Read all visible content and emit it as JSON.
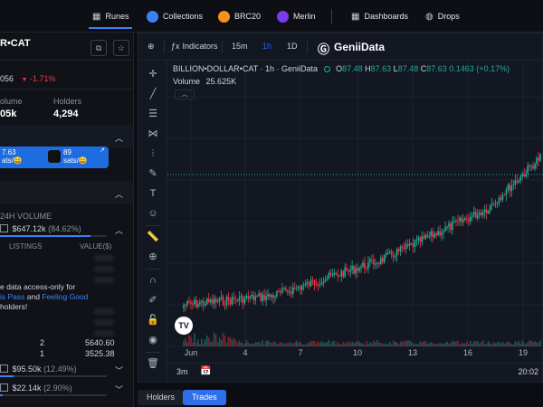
{
  "nav": {
    "items": [
      {
        "label": "Runes",
        "icon": "grid-icon"
      },
      {
        "label": "Collections",
        "icon": "collections-icon"
      },
      {
        "label": "BRC20",
        "icon": "brc20-icon"
      },
      {
        "label": "Merlin",
        "icon": "merlin-icon"
      },
      {
        "label": "Dashboards",
        "icon": "dashboard-icon"
      },
      {
        "label": "Drops",
        "icon": "drops-icon"
      }
    ],
    "active": "Runes"
  },
  "token": {
    "name_partial": "R•CAT",
    "price_partial": "056",
    "change": "-1.71%",
    "volume_label_partial": "olume",
    "volume_value_partial": "05k",
    "holders_label": "Holders",
    "holders_value": "4,294"
  },
  "cards": [
    {
      "value_partial": "7.63",
      "sub_partial": "ats/"
    },
    {
      "value": "89",
      "sub": "sats/"
    }
  ],
  "market": {
    "header_partial": "24H VOLUME",
    "first": {
      "value": "$647.12k",
      "pct": "(84.62%)",
      "fill_pct": 84.62
    },
    "listings_label": "LISTINGS",
    "value_label": "VALUE($)",
    "notice_line1": "e data access-only for",
    "notice_link1_partial": "is Pass",
    "notice_and": "and",
    "notice_link2": "Feeling Good",
    "notice_line3": "holders!",
    "rows": [
      {
        "listings": "2",
        "value": "5640.60"
      },
      {
        "listings": "1",
        "value": "3525.38"
      }
    ],
    "second": {
      "value": "$95.50k",
      "pct": "(12.49%)",
      "fill_pct": 12.49
    },
    "third": {
      "value": "$22.14k",
      "pct": "(2.90%)",
      "fill_pct": 2.9
    }
  },
  "chart_toolbar": {
    "indicators": "Indicators",
    "intervals": [
      "15m",
      "1h",
      "1D"
    ],
    "active_interval": "1h",
    "brand": "GeniiData"
  },
  "legend": {
    "symbol": "BILLION•DOLLAR•CAT · 1h · GeniiData",
    "o_label": "O",
    "o": "87.48",
    "h_label": "H",
    "h": "87.63",
    "l_label": "L",
    "l": "87.48",
    "c_label": "C",
    "c": "87.63",
    "chg": "0.1463 (+0.17%)",
    "volume_label": "Volume",
    "volume_value": "25.625K"
  },
  "xaxis": {
    "ticks": [
      "Jun",
      "4",
      "7",
      "10",
      "13",
      "16",
      "19"
    ]
  },
  "bottom": {
    "range": "3m",
    "time": "20:02"
  },
  "tabs": [
    {
      "label": "Holders",
      "active": false
    },
    {
      "label": "Trades",
      "active": true
    }
  ],
  "colors": {
    "up": "#22ab94",
    "down": "#f23645",
    "accent": "#3b82f6"
  },
  "chart_data": {
    "type": "candlestick",
    "title": "BILLION•DOLLAR•CAT · 1h · GeniiData",
    "x_ticks": [
      "Jun",
      "4",
      "7",
      "10",
      "13",
      "16",
      "19"
    ],
    "last": {
      "open": 87.48,
      "high": 87.63,
      "low": 87.48,
      "close": 87.63
    },
    "volume_last": "25.625K"
  }
}
